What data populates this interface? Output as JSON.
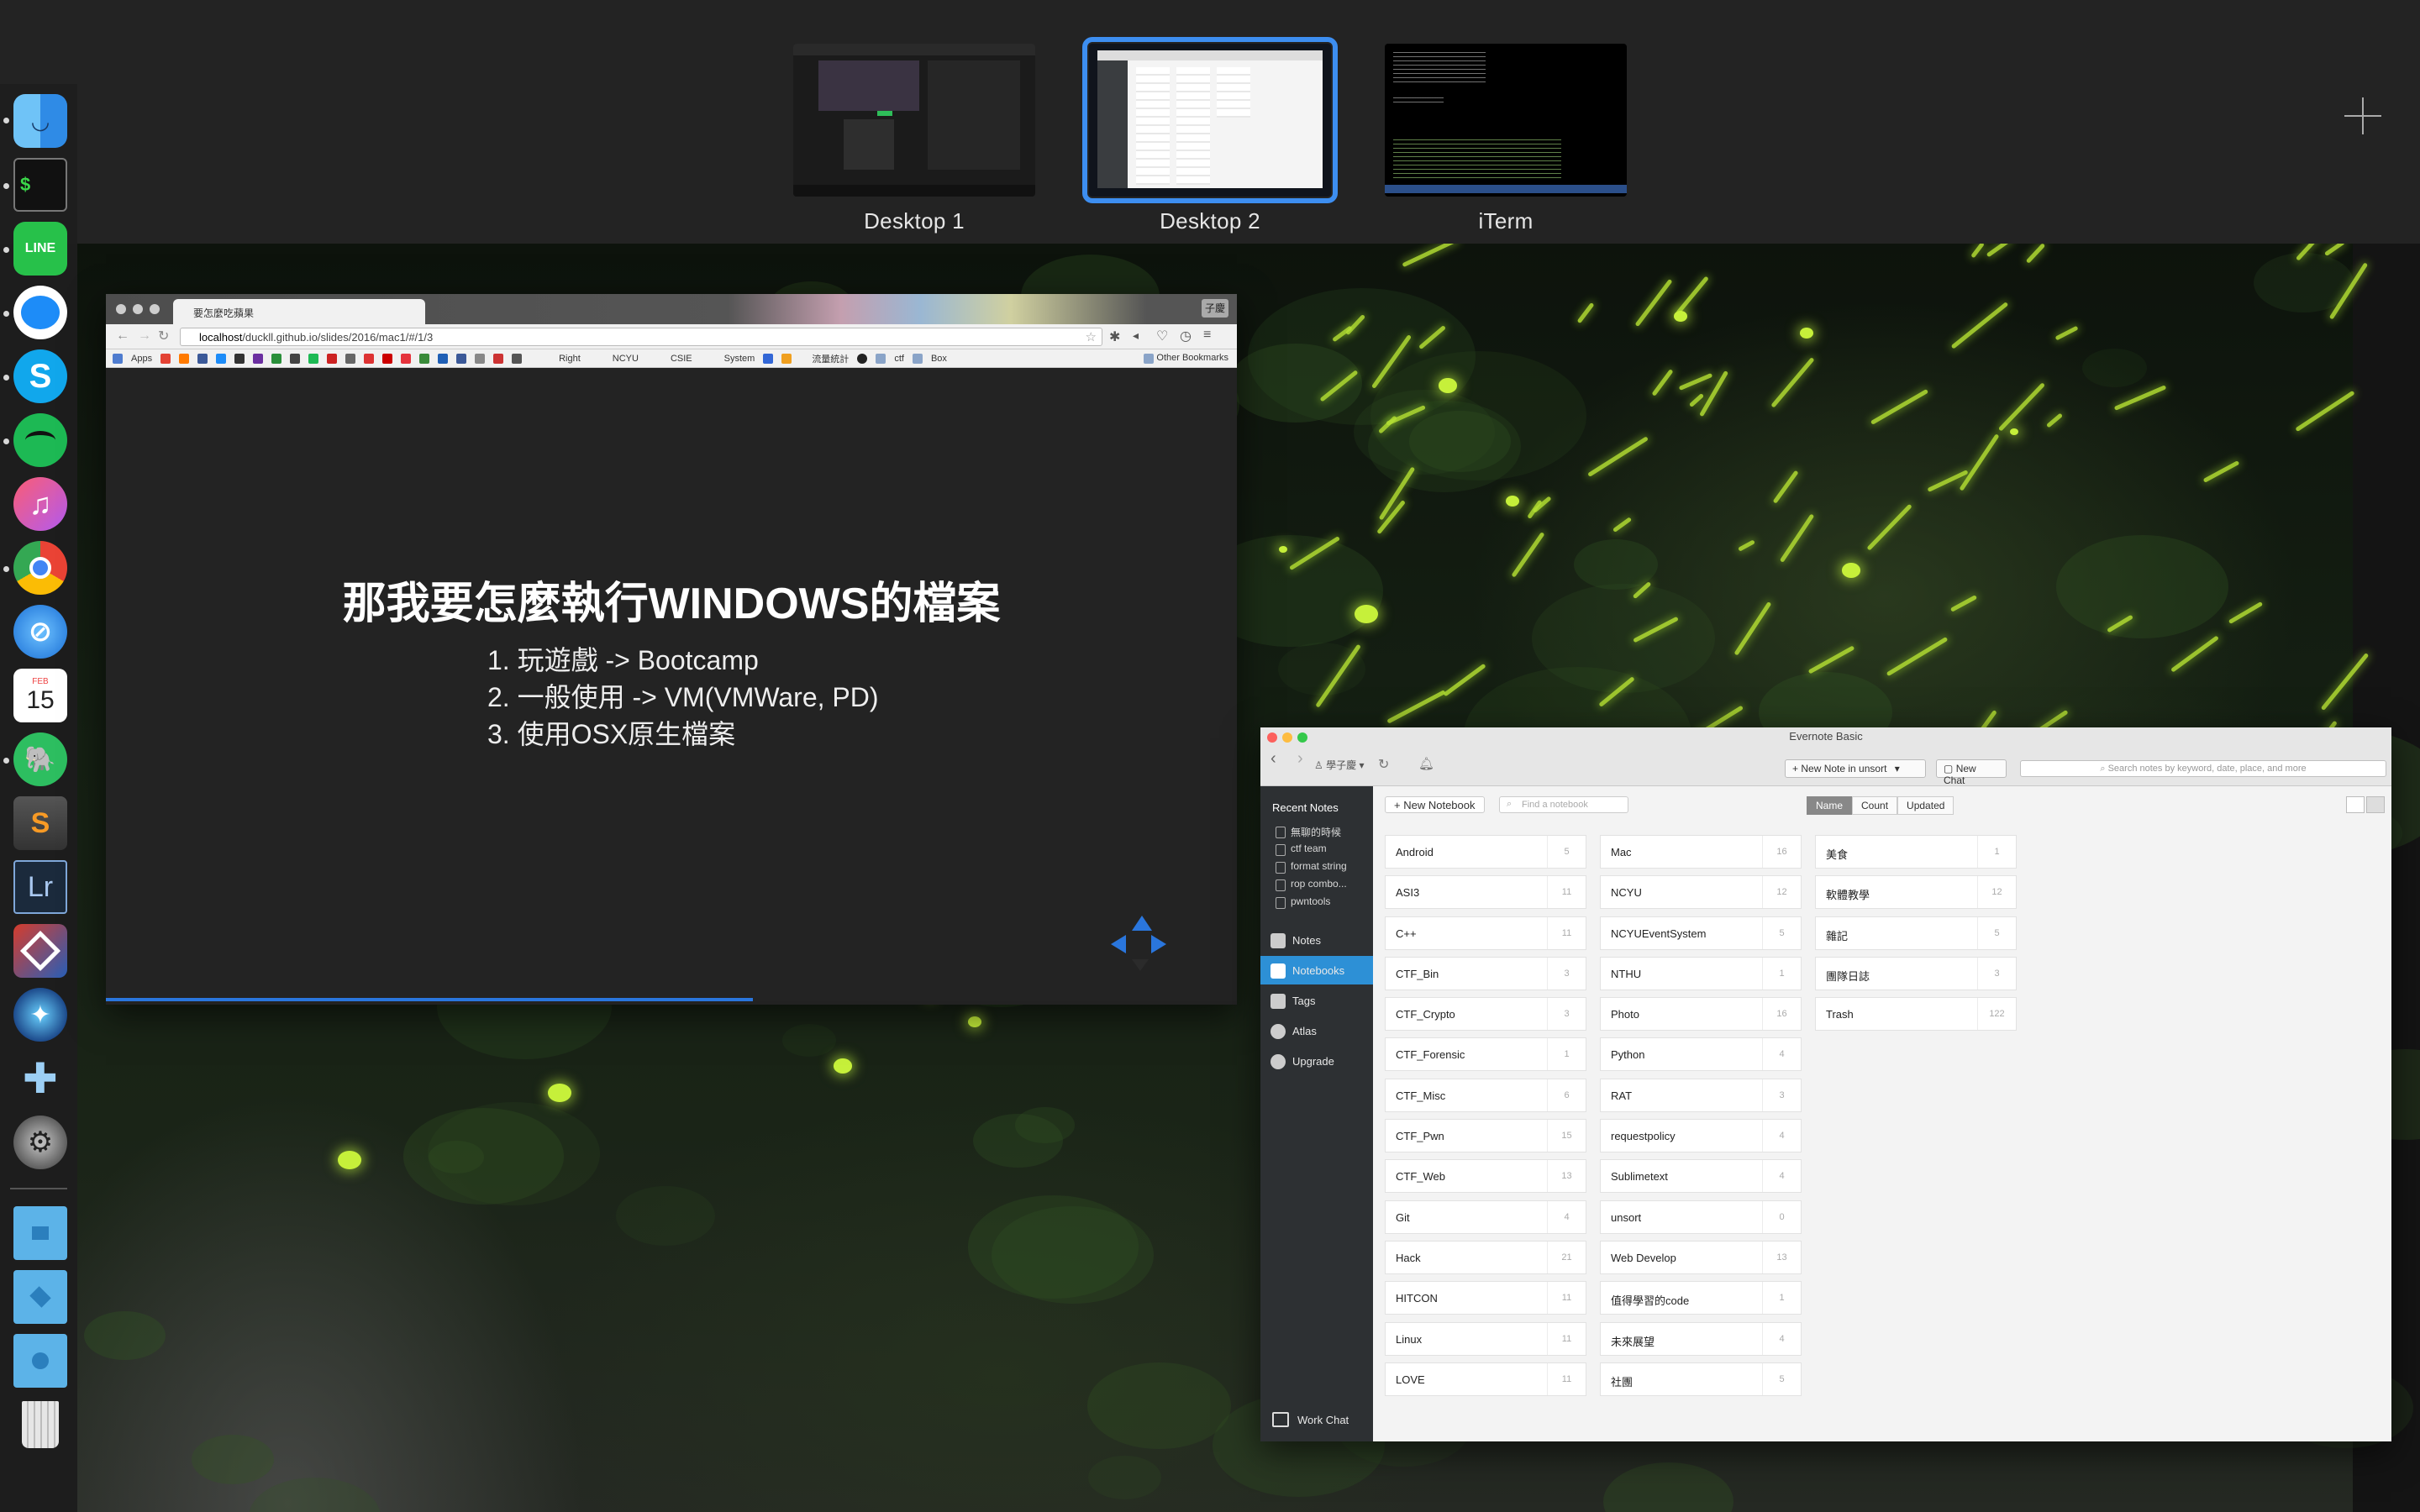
{
  "spaces": [
    {
      "label": "Desktop 1",
      "active": false
    },
    {
      "label": "Desktop 2",
      "active": true
    },
    {
      "label": "iTerm",
      "active": false
    }
  ],
  "add_space_icon": "plus-icon",
  "dock": {
    "items": [
      "finder",
      "terminal",
      "line",
      "messenger",
      "skype",
      "spotify",
      "itunes",
      "chrome",
      "safari",
      "calendar",
      "evernote",
      "sublime-text",
      "lightroom",
      "parallels",
      "xcode-instruments",
      "ppsspp",
      "system-preferences"
    ],
    "folders": [
      "dropbox-folder",
      "apps-folder",
      "downloads-folder"
    ],
    "calendar_month": "FEB",
    "calendar_day": "15",
    "line_label": "LINE",
    "lightroom_label": "Lr"
  },
  "chrome": {
    "tab_title": "要怎麼吃蘋果",
    "profile": "子慶",
    "url_host": "localhost",
    "url_path": "/duckll.github.io/slides/2016/mac1/#/1/3",
    "bookmarks": [
      "Apps",
      "Right",
      "NCYU",
      "CSIE",
      "System",
      "流量統計",
      "ctf",
      "Box"
    ],
    "other_bookmarks": "Other Bookmarks",
    "slide": {
      "title": "那我要怎麼執行WINDOWS的檔案",
      "items": [
        "1. 玩遊戲 -> Bootcamp",
        "2. 一般使用 -> VM(VMWare, PD)",
        "3. 使用OSX原生檔案"
      ]
    }
  },
  "evernote": {
    "title": "Evernote Basic",
    "user": "學子慶",
    "new_note": "New Note in unsort",
    "new_chat": "New Chat",
    "search_placeholder": "Search notes by keyword, date, place, and more",
    "recent_notes_title": "Recent Notes",
    "recent_notes": [
      "無聊的時候",
      "ctf team",
      "format string",
      "rop combo...",
      "pwntools"
    ],
    "nav": [
      {
        "label": "Notes",
        "icon": "notes-icon",
        "active": false
      },
      {
        "label": "Notebooks",
        "icon": "notebooks-icon",
        "active": true
      },
      {
        "label": "Tags",
        "icon": "tag-icon",
        "active": false
      },
      {
        "label": "Atlas",
        "icon": "globe-icon",
        "active": false
      },
      {
        "label": "Upgrade",
        "icon": "upgrade-icon",
        "active": false
      }
    ],
    "work_chat": "Work Chat",
    "new_notebook": "New Notebook",
    "find_placeholder": "Find a notebook",
    "sort": [
      "Name",
      "Count",
      "Updated"
    ],
    "sort_active": "Name",
    "notebook_columns": [
      [
        {
          "name": "Android",
          "count": "5"
        },
        {
          "name": "ASI3",
          "count": "11"
        },
        {
          "name": "C++",
          "count": "11"
        },
        {
          "name": "CTF_Bin",
          "count": "3"
        },
        {
          "name": "CTF_Crypto",
          "count": "3"
        },
        {
          "name": "CTF_Forensic",
          "count": "1"
        },
        {
          "name": "CTF_Misc",
          "count": "6"
        },
        {
          "name": "CTF_Pwn",
          "count": "15"
        },
        {
          "name": "CTF_Web",
          "count": "13"
        },
        {
          "name": "Git",
          "count": "4"
        },
        {
          "name": "Hack",
          "count": "21"
        },
        {
          "name": "HITCON",
          "count": "11"
        },
        {
          "name": "Linux",
          "count": "11"
        },
        {
          "name": "LOVE",
          "count": "11"
        }
      ],
      [
        {
          "name": "Mac",
          "count": "16"
        },
        {
          "name": "NCYU",
          "count": "12"
        },
        {
          "name": "NCYUEventSystem",
          "count": "5"
        },
        {
          "name": "NTHU",
          "count": "1"
        },
        {
          "name": "Photo",
          "count": "16"
        },
        {
          "name": "Python",
          "count": "4"
        },
        {
          "name": "RAT",
          "count": "3"
        },
        {
          "name": "requestpolicy",
          "count": "4"
        },
        {
          "name": "Sublimetext",
          "count": "4"
        },
        {
          "name": "unsort",
          "count": "0"
        },
        {
          "name": "Web Develop",
          "count": "13"
        },
        {
          "name": "值得學習的code",
          "count": "1"
        },
        {
          "name": "未來展望",
          "count": "4"
        },
        {
          "name": "社團",
          "count": "5"
        }
      ],
      [
        {
          "name": "美食",
          "count": "1"
        },
        {
          "name": "軟體教學",
          "count": "12"
        },
        {
          "name": "雜記",
          "count": "5"
        },
        {
          "name": "團隊日誌",
          "count": "3"
        },
        {
          "name": "Trash",
          "count": "122"
        }
      ]
    ]
  },
  "colors": {
    "accent_blue": "#3d8ef0",
    "evernote_selected": "#2d90d6",
    "firefly": "#c6f03a"
  }
}
